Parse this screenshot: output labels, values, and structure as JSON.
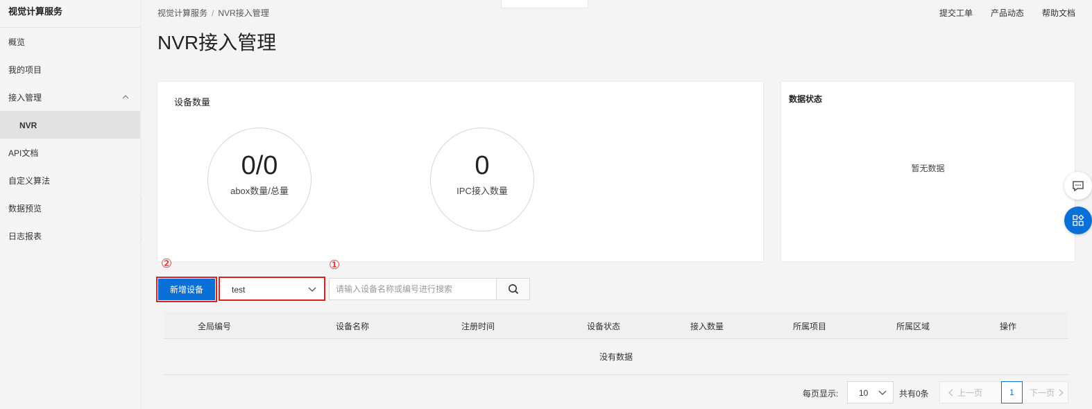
{
  "sidebar": {
    "title": "视觉计算服务",
    "items": [
      {
        "label": "概览"
      },
      {
        "label": "我的项目"
      },
      {
        "label": "接入管理"
      },
      {
        "label": "NVR"
      },
      {
        "label": "API文档"
      },
      {
        "label": "自定义算法"
      },
      {
        "label": "数据预览"
      },
      {
        "label": "日志报表"
      }
    ]
  },
  "header": {
    "breadcrumb": [
      "视觉计算服务",
      "NVR接入管理"
    ],
    "breadcrumb_sep": "/",
    "links": [
      "提交工单",
      "产品动态",
      "帮助文档"
    ],
    "title": "NVR接入管理"
  },
  "devices_card": {
    "title": "设备数量",
    "stats": [
      {
        "value": "0/0",
        "label": "abox数量/总量"
      },
      {
        "value": "0",
        "label": "IPC接入数量"
      }
    ]
  },
  "status_card": {
    "title": "数据状态",
    "empty_text": "暂无数据"
  },
  "toolbar": {
    "annotation_1": "①",
    "annotation_2": "②",
    "add_button": "新增设备",
    "project_select": "test",
    "search_placeholder": "请输入设备名称或编号进行搜索"
  },
  "table": {
    "columns": [
      "全局编号",
      "设备名称",
      "注册时间",
      "设备状态",
      "接入数量",
      "所属项目",
      "所属区域",
      "操作"
    ],
    "empty_text": "没有数据"
  },
  "pagination": {
    "per_page_label": "每页显示:",
    "per_page_value": "10",
    "total_text": "共有0条",
    "prev_label": "上一页",
    "current_page": "1",
    "next_label": "下一页"
  },
  "colors": {
    "primary": "#0a70d8",
    "annotation": "#e02020"
  }
}
